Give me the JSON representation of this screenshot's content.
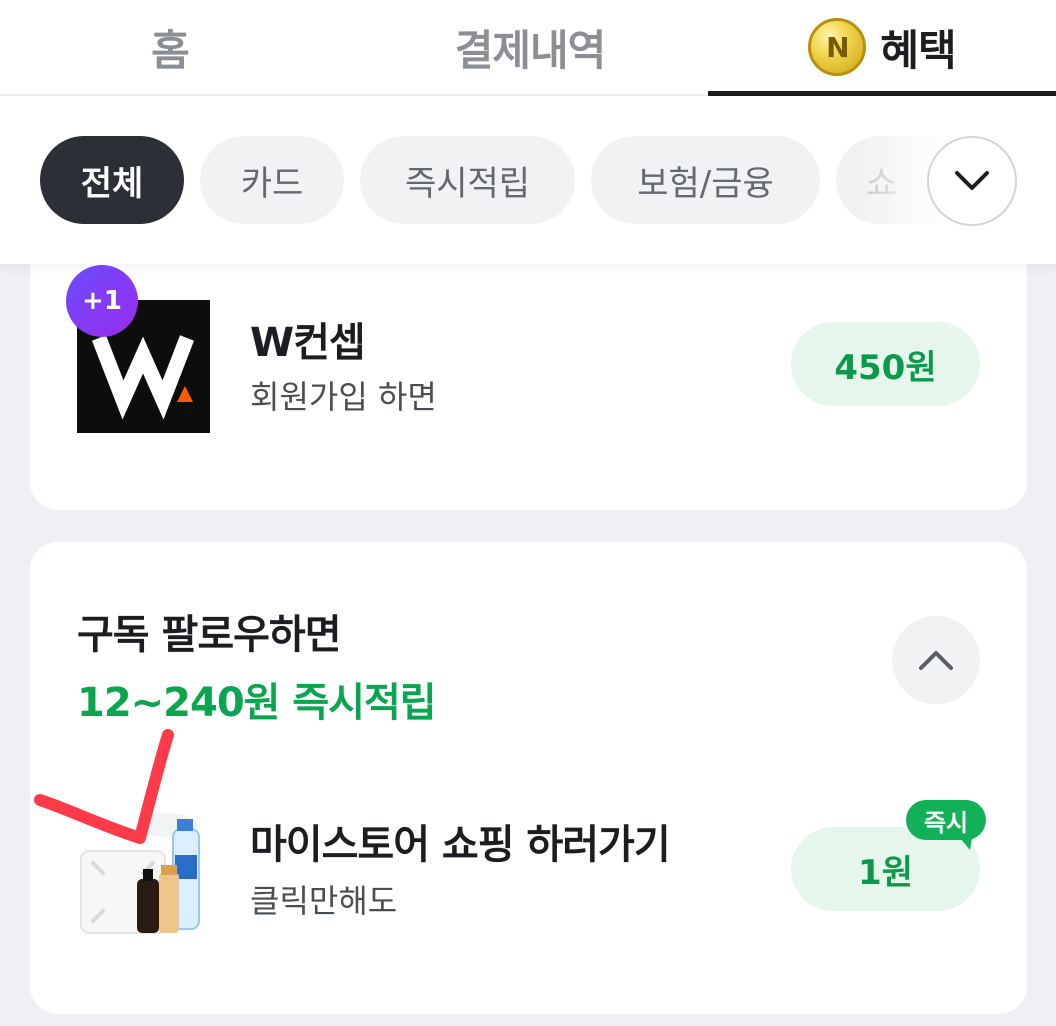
{
  "tabs": {
    "home": "홈",
    "history": "결제내역",
    "benefit": "혜택",
    "coin_letter": "N"
  },
  "filters": [
    "전체",
    "카드",
    "즉시적립",
    "보험/금융",
    "쇼"
  ],
  "card1": {
    "badge": "+1",
    "title": "W컨셉",
    "subtitle": "회원가입 하면",
    "reward": "450원"
  },
  "subscribe_section": {
    "title": "구독 팔로우하면",
    "amount": "12~240원 즉시적립",
    "item": {
      "title": "마이스토어 쇼핑 하러가기",
      "subtitle": "클릭만해도",
      "reward": "1원",
      "badge": "즉시"
    }
  },
  "colors": {
    "accent_green": "#0aa64f",
    "dark": "#1b1d21",
    "annotation_red": "#ff3b4a"
  },
  "icons": {
    "expand": "chevron-down-icon",
    "collapse": "chevron-up-icon",
    "coin": "npay-coin-icon"
  }
}
